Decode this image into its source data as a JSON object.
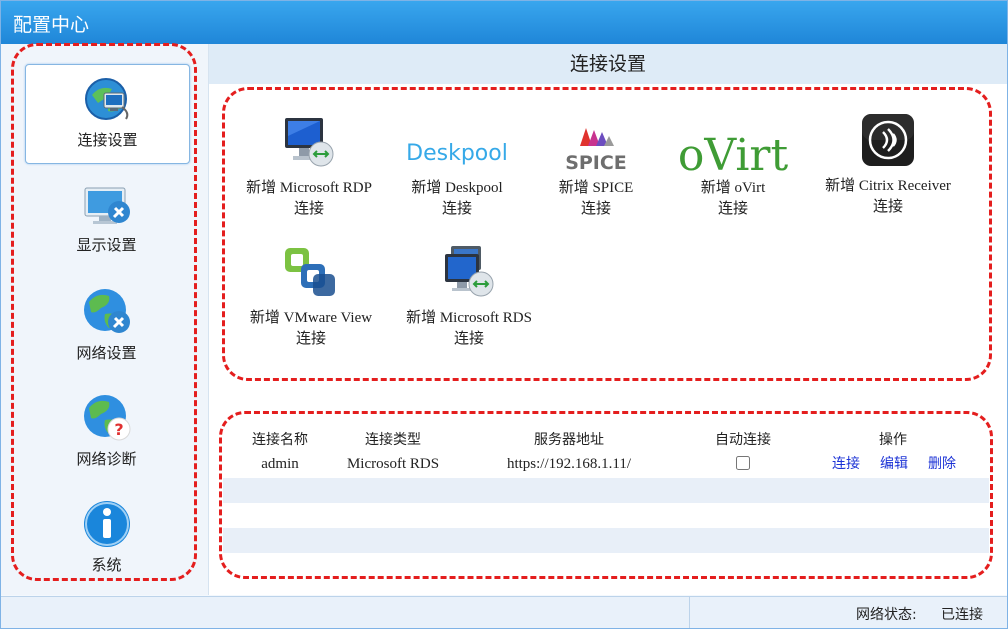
{
  "app": {
    "title": "配置中心"
  },
  "sidebar": {
    "items": [
      {
        "label": "连接设置",
        "icon": "connection-settings-icon",
        "active": true
      },
      {
        "label": "显示设置",
        "icon": "display-settings-icon",
        "active": false
      },
      {
        "label": "网络设置",
        "icon": "network-settings-icon",
        "active": false
      },
      {
        "label": "网络诊断",
        "icon": "network-diagnostics-icon",
        "active": false
      },
      {
        "label": "系统",
        "icon": "system-info-icon",
        "active": false
      }
    ]
  },
  "main": {
    "header": "连接设置",
    "connection_types": [
      {
        "line1": "新增 Microsoft RDP",
        "line2": "连接",
        "icon": "microsoft-rdp-icon"
      },
      {
        "line1": "新增 Deskpool",
        "line2": "连接",
        "icon": "deskpool-logo",
        "logo_text": "Deskpool"
      },
      {
        "line1": "新增 SPICE",
        "line2": "连接",
        "icon": "spice-logo",
        "logo_text": "SPICE"
      },
      {
        "line1": "新增 oVirt",
        "line2": "连接",
        "icon": "ovirt-logo",
        "logo_text": "oVirt"
      },
      {
        "line1": "新增 Citrix Receiver",
        "line2": "连接",
        "icon": "citrix-receiver-icon"
      },
      {
        "line1": "新增 VMware View",
        "line2": "连接",
        "icon": "vmware-view-icon"
      },
      {
        "line1": "新增 Microsoft RDS",
        "line2": "连接",
        "icon": "microsoft-rds-icon"
      }
    ],
    "table": {
      "headers": [
        "连接名称",
        "连接类型",
        "服务器地址",
        "自动连接",
        "操作"
      ],
      "rows": [
        {
          "name": "admin",
          "type": "Microsoft RDS",
          "server": "https://192.168.1.11/",
          "auto_connect": false,
          "actions": [
            "连接",
            "编辑",
            "删除"
          ]
        }
      ]
    }
  },
  "status": {
    "label": "网络状态:",
    "value": "已连接"
  },
  "colors": {
    "title_bar": "#2a95e3",
    "highlight_dash": "#e41e1e",
    "link": "#1c33d6",
    "header_bg": "#deebf7"
  }
}
